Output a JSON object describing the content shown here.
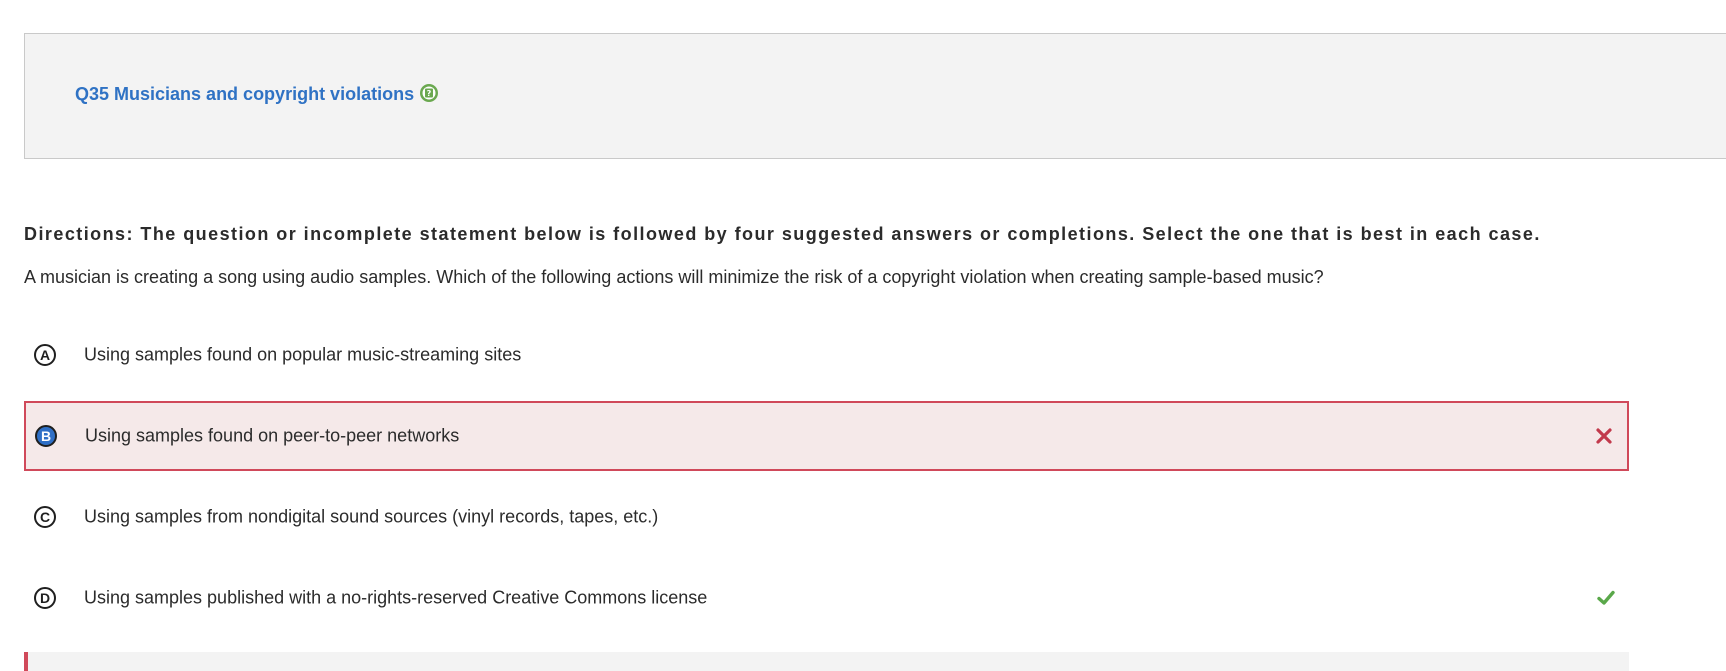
{
  "header": {
    "question_title": "Q35 Musicians and copyright violations",
    "help_icon": "question-help-icon",
    "help_icon_color": "#6aa84f"
  },
  "directions": "Directions: The question or incomplete statement below is followed by four suggested answers or completions. Select the one that is best in each case.",
  "question": "A musician is creating a song using audio samples. Which of the following actions will minimize the risk of a copyright violation when creating sample-based music?",
  "options": [
    {
      "letter": "A",
      "text": "Using samples found on popular music-streaming sites",
      "state": "default"
    },
    {
      "letter": "B",
      "text": "Using samples found on peer-to-peer networks",
      "state": "selected-incorrect",
      "mark_icon": "cross-icon"
    },
    {
      "letter": "C",
      "text": "Using samples from nondigital sound sources (vinyl records, tapes, etc.)",
      "state": "default"
    },
    {
      "letter": "D",
      "text": "Using samples published with a no-rights-reserved Creative Commons license",
      "state": "correct",
      "mark_icon": "check-icon"
    }
  ],
  "colors": {
    "title_link": "#2f72c4",
    "incorrect": "#d0495a",
    "incorrect_bg": "#f5e9e9",
    "correct": "#5aa84a",
    "selected_letter": "#2f6fc6"
  }
}
